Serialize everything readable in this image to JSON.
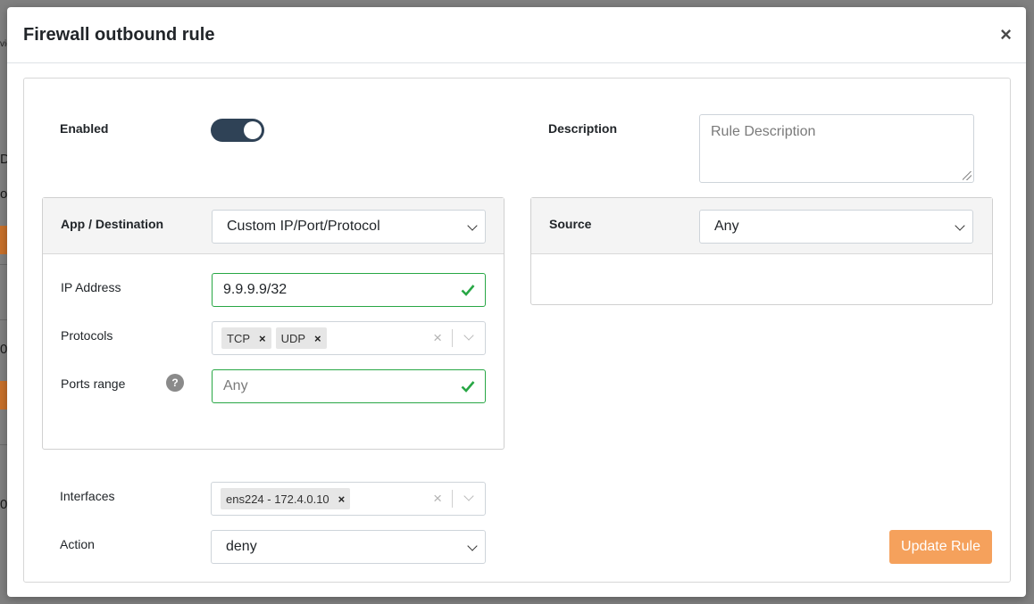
{
  "background": {
    "frag1": "vic",
    "frag2": "D",
    "frag3": "ol",
    "frag4": "+",
    "frag5": "0",
    "frag6": "0"
  },
  "modal": {
    "title": "Firewall outbound rule",
    "close_label": "×"
  },
  "form": {
    "enabled_label": "Enabled",
    "enabled": true,
    "description_label": "Description",
    "description_placeholder": "Rule Description",
    "app_destination_label": "App / Destination",
    "app_destination_value": "Custom IP/Port/Protocol",
    "source_label": "Source",
    "source_value": "Any",
    "ip_address_label": "IP Address",
    "ip_address_value": "9.9.9.9/32",
    "protocols_label": "Protocols",
    "protocols": [
      "TCP",
      "UDP"
    ],
    "ports_range_label": "Ports range",
    "ports_range_placeholder": "Any",
    "help_icon": "?",
    "interfaces_label": "Interfaces",
    "interfaces": [
      "ens224 - 172.4.0.10"
    ],
    "action_label": "Action",
    "action_value": "deny",
    "submit_label": "Update Rule",
    "tag_remove": "×",
    "clear_all": "×"
  },
  "colors": {
    "toggle_on": "#2f4256",
    "valid_green": "#28a745",
    "update_button": "#f5a15c"
  }
}
